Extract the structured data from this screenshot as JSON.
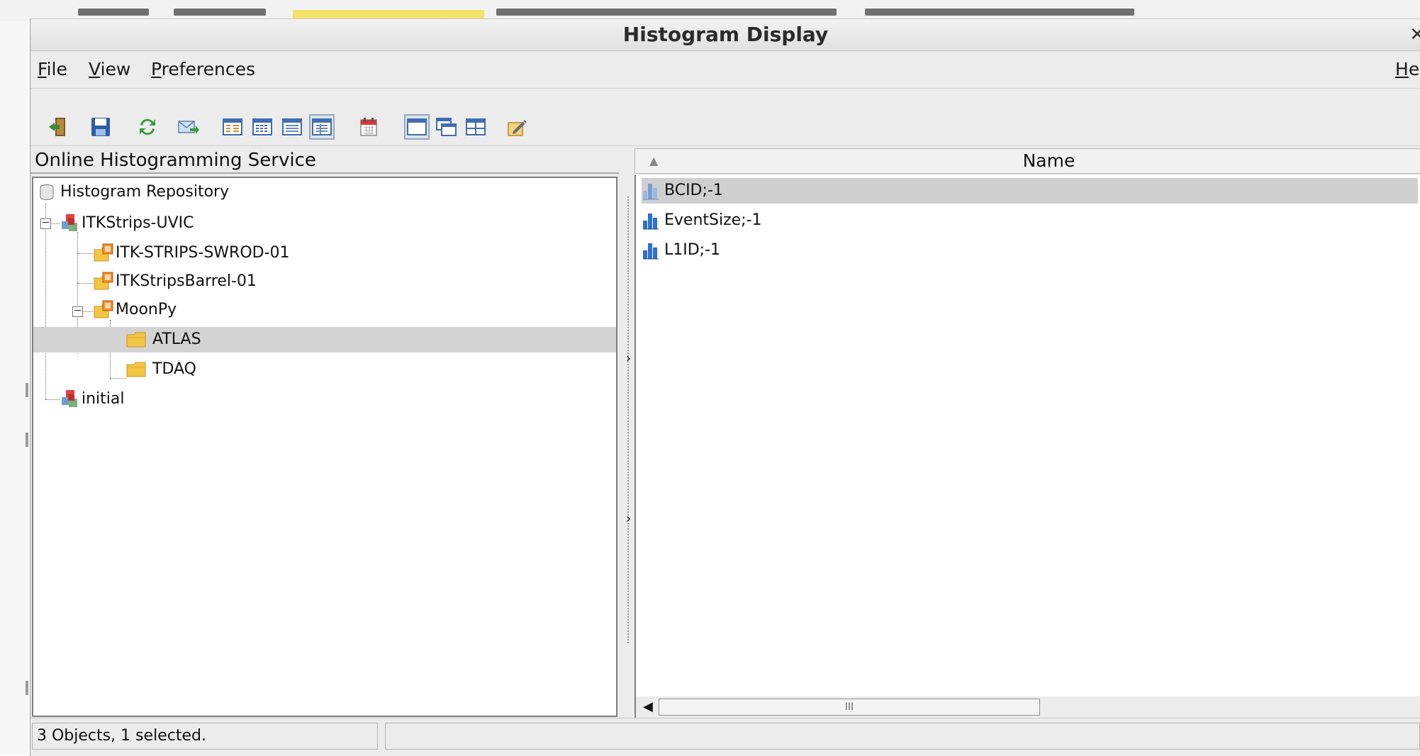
{
  "window": {
    "title": "Histogram Display"
  },
  "menus": [
    {
      "label": "File",
      "mnemonic": "F",
      "rest": "ile"
    },
    {
      "label": "View",
      "mnemonic": "V",
      "rest": "iew"
    },
    {
      "label": "Preferences",
      "mnemonic": "P",
      "rest": "references"
    },
    {
      "label": "Help",
      "mnemonic": "H",
      "rest": "elp"
    }
  ],
  "toolbar": {
    "icons": [
      "exit-icon",
      "save-icon",
      "refresh-icon",
      "send-icon",
      "table-view-1-icon",
      "table-view-2-icon",
      "table-view-3-icon",
      "table-view-4-icon",
      "calendar-icon",
      "single-window-icon",
      "cascade-window-icon",
      "tile-window-icon",
      "edit-preferences-icon"
    ]
  },
  "left_pane": {
    "header": "Online Histogramming Service",
    "tree": [
      {
        "label": "Histogram Repository",
        "icon": "database-icon"
      },
      {
        "label": "ITKStrips-UVIC",
        "icon": "partition-icon"
      },
      {
        "label": "ITK-STRIPS-SWROD-01",
        "icon": "server-folder-icon"
      },
      {
        "label": "ITKStripsBarrel-01",
        "icon": "server-folder-icon"
      },
      {
        "label": "MoonPy",
        "icon": "server-folder-icon"
      },
      {
        "label": "ATLAS",
        "icon": "folder-icon"
      },
      {
        "label": "TDAQ",
        "icon": "folder-icon"
      },
      {
        "label": "initial",
        "icon": "partition-icon"
      }
    ]
  },
  "right_pane": {
    "column_header": "Name",
    "items": [
      {
        "label": "BCID;-1",
        "icon": "histogram-icon"
      },
      {
        "label": "EventSize;-1",
        "icon": "histogram-icon"
      },
      {
        "label": "L1ID;-1",
        "icon": "histogram-icon"
      }
    ],
    "scroll_thumb_grip": "III"
  },
  "status": {
    "text": "3 Objects, 1 selected."
  },
  "colors": {
    "selection": "#d3d3d3",
    "window_bg": "#ececec",
    "folder": "#f5c542",
    "partition": "#d83b3b",
    "histogram": "#2f6fd1"
  }
}
